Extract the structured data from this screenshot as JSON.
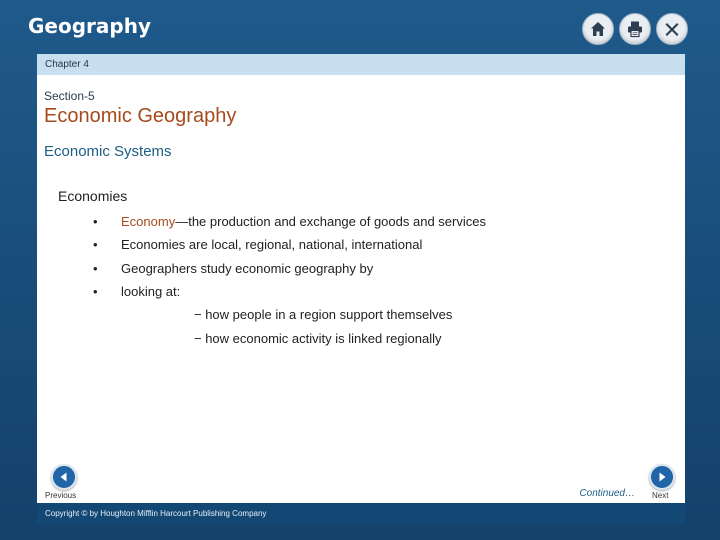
{
  "app": {
    "title": "Geography"
  },
  "toolbar": {
    "icons": [
      "home-icon",
      "print-icon",
      "close-icon"
    ]
  },
  "chapter": {
    "label": "Chapter 4"
  },
  "section": {
    "label": "Section-5"
  },
  "main": {
    "title": "Economic Geography",
    "subtitle": "Economic Systems",
    "heading": "Economies",
    "bullets": [
      {
        "bullet": "•",
        "term": "Economy",
        "text": "—the production and exchange of goods and services"
      },
      {
        "bullet": "•",
        "text": "Economies are local, regional, national, international"
      },
      {
        "bullet": "•",
        "text": "Geographers study economic geography by"
      },
      {
        "bullet": "•",
        "text": "looking at:"
      }
    ],
    "sub_items": [
      "− how people in a region support themselves",
      "− how economic activity is linked regionally"
    ]
  },
  "nav": {
    "previous_label": "Previous",
    "next_label": "Next",
    "continued": "Continued…"
  },
  "footer": {
    "copyright": "Copyright © by Houghton Mifflin Harcourt Publishing Company"
  },
  "colors": {
    "accent_title": "#a64b1e",
    "subtitle": "#1d5d86",
    "frame": "#1f5a8c",
    "chapter_bar": "#c7dfef"
  }
}
